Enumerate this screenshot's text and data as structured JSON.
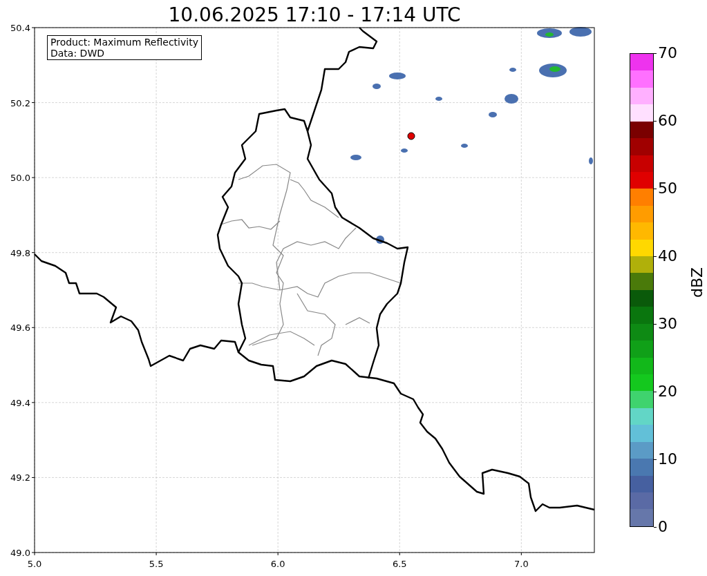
{
  "title": "10.06.2025 17:10 - 17:14 UTC",
  "info_box": [
    "Product: Maximum Reflectivity",
    "Data: DWD"
  ],
  "map": {
    "x_ticks": [
      "5.0",
      "5.5",
      "6.0",
      "6.5",
      "7.0"
    ],
    "y_ticks": [
      "50.4",
      "50.2",
      "50.0",
      "49.8",
      "49.6",
      "49.4",
      "49.2",
      "49.0"
    ]
  },
  "colorbar": {
    "label": "dBZ",
    "ticks": [
      "70",
      "60",
      "50",
      "40",
      "30",
      "20",
      "10",
      "0"
    ],
    "bands": [
      {
        "color": "#ee33ee"
      },
      {
        "color": "#ff70ff"
      },
      {
        "color": "#ffb0ff"
      },
      {
        "color": "#ffe0ff"
      },
      {
        "color": "#7a0000"
      },
      {
        "color": "#a00000"
      },
      {
        "color": "#c80000"
      },
      {
        "color": "#e00000"
      },
      {
        "color": "#ff7f00"
      },
      {
        "color": "#ff9c00"
      },
      {
        "color": "#ffb800"
      },
      {
        "color": "#ffd800"
      },
      {
        "color": "#b0b00a"
      },
      {
        "color": "#4a7a0a"
      },
      {
        "color": "#0a5a0a"
      },
      {
        "color": "#0a760e"
      },
      {
        "color": "#0e8a14"
      },
      {
        "color": "#10a018"
      },
      {
        "color": "#12b81a"
      },
      {
        "color": "#14c81e"
      },
      {
        "color": "#3fd36e"
      },
      {
        "color": "#62d6c6"
      },
      {
        "color": "#62c0d8"
      },
      {
        "color": "#5b9bc6"
      },
      {
        "color": "#4a78b0"
      },
      {
        "color": "#4660a0"
      },
      {
        "color": "#5a6aa5"
      },
      {
        "color": "#6677aa"
      }
    ]
  }
}
